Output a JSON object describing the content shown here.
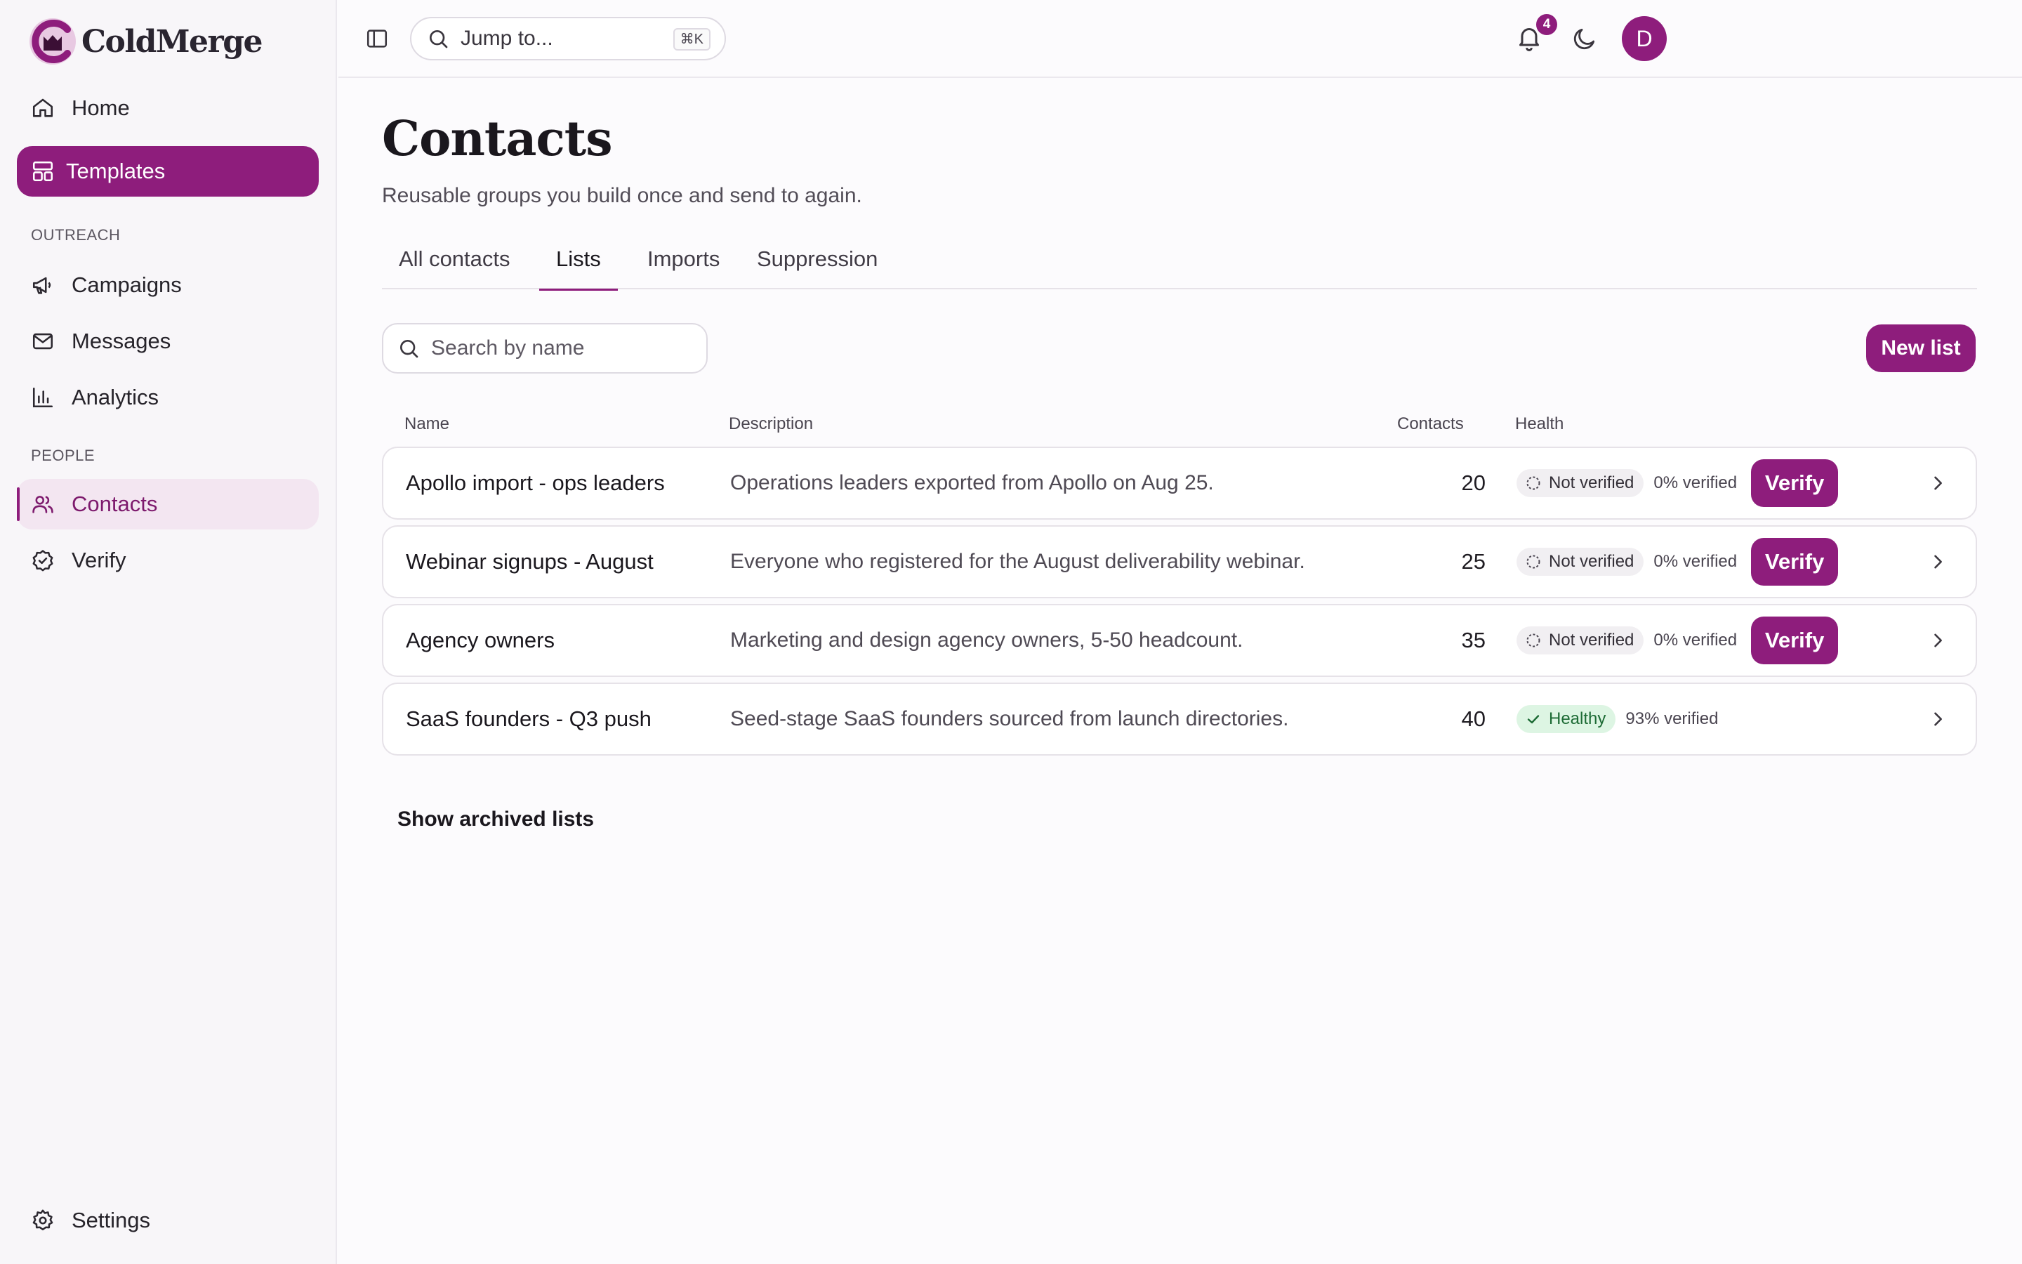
{
  "app": {
    "name": "ColdMerge"
  },
  "sidebar": {
    "items_top": [
      {
        "label": "Home",
        "icon": "home-icon"
      },
      {
        "label": "Templates",
        "icon": "template-icon"
      }
    ],
    "sections": [
      {
        "title": "OUTREACH",
        "items": [
          {
            "label": "Campaigns",
            "icon": "megaphone-icon"
          },
          {
            "label": "Messages",
            "icon": "mail-icon"
          },
          {
            "label": "Analytics",
            "icon": "bar-chart-icon"
          }
        ]
      },
      {
        "title": "PEOPLE",
        "items": [
          {
            "label": "Contacts",
            "icon": "users-icon"
          },
          {
            "label": "Verify",
            "icon": "check-circle-icon"
          }
        ]
      }
    ],
    "settings": {
      "label": "Settings",
      "icon": "gear-icon"
    }
  },
  "topbar": {
    "jump_label": "Jump to...",
    "jump_shortcut": "⌘K",
    "notification_count": "4",
    "avatar_initial": "D"
  },
  "page": {
    "title": "Contacts",
    "subtitle": "Reusable groups you build once and send to again.",
    "tabs": [
      "All contacts",
      "Lists",
      "Imports",
      "Suppression"
    ],
    "active_tab": "Lists",
    "search_placeholder": "Search by name",
    "new_list_label": "New list",
    "columns": [
      "Name",
      "Description",
      "Contacts",
      "Health"
    ],
    "rows": [
      {
        "name": "Apollo import - ops leaders",
        "description": "Operations leaders exported from Apollo on Aug 25.",
        "contacts": "20",
        "status": "Not verified",
        "verified": "0% verified",
        "action": "Verify"
      },
      {
        "name": "Webinar signups - August",
        "description": "Everyone who registered for the August deliverability webinar.",
        "contacts": "25",
        "status": "Not verified",
        "verified": "0% verified",
        "action": "Verify"
      },
      {
        "name": "Agency owners",
        "description": "Marketing and design agency owners, 5-50 headcount.",
        "contacts": "35",
        "status": "Not verified",
        "verified": "0% verified",
        "action": "Verify"
      },
      {
        "name": "SaaS founders - Q3 push",
        "description": "Seed-stage SaaS founders sourced from launch directories.",
        "contacts": "40",
        "status": "Healthy",
        "verified": "93% verified",
        "action": ""
      }
    ],
    "archived_label": "Show archived lists"
  },
  "colors": {
    "accent": "#8e1d7c",
    "accent_soft": "#f3e6f1",
    "healthy_bg": "#ddf5e3",
    "healthy_fg": "#1d6b35"
  }
}
